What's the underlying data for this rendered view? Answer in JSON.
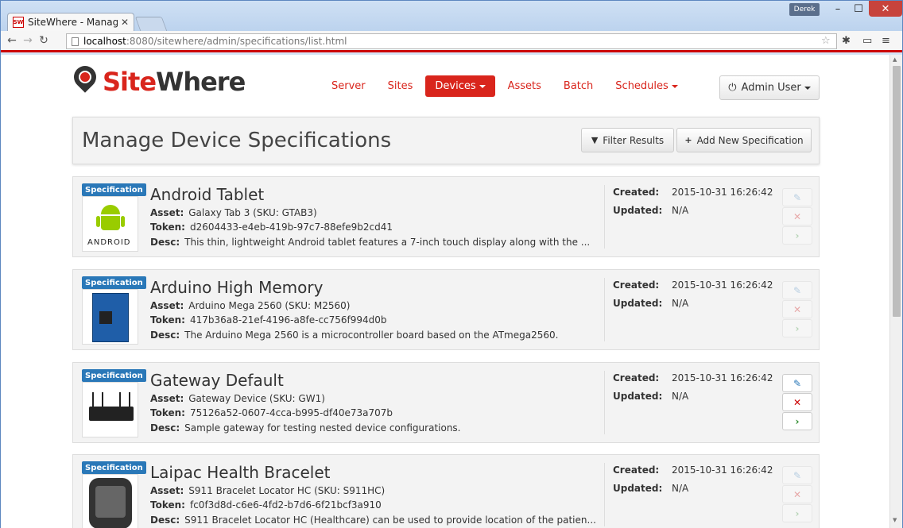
{
  "browser": {
    "tab_title": "SiteWhere - Manage",
    "favicon_text": "SW",
    "user_badge": "Derek",
    "url_host": "localhost",
    "url_path": ":8080/sitewhere/admin/specifications/list.html"
  },
  "header": {
    "logo_site": "Site",
    "logo_where": "Where",
    "nav": [
      "Server",
      "Sites",
      "Devices",
      "Assets",
      "Batch",
      "Schedules"
    ],
    "user_label": "Admin User"
  },
  "page": {
    "title": "Manage Device Specifications",
    "filter_label": "Filter Results",
    "add_label": "Add New Specification"
  },
  "labels": {
    "badge": "Specification",
    "asset": "Asset:",
    "token": "Token:",
    "desc": "Desc:",
    "created": "Created:",
    "updated": "Updated:",
    "android_word": "ANDROID"
  },
  "specs": [
    {
      "name": "Android Tablet",
      "asset": "Galaxy Tab 3 (SKU: GTAB3)",
      "token": "d2604433-e4eb-419b-97c7-88efe9b2cd41",
      "desc": "This thin, lightweight Android tablet features a 7-inch touch display along with the ...",
      "created": "2015-10-31 16:26:42",
      "updated": "N/A"
    },
    {
      "name": "Arduino High Memory",
      "asset": "Arduino Mega 2560 (SKU: M2560)",
      "token": "417b36a8-21ef-4196-a8fe-cc756f994d0b",
      "desc": "The Arduino Mega 2560 is a microcontroller board based on the ATmega2560.",
      "created": "2015-10-31 16:26:42",
      "updated": "N/A"
    },
    {
      "name": "Gateway Default",
      "asset": "Gateway Device (SKU: GW1)",
      "token": "75126a52-0607-4cca-b995-df40e73a707b",
      "desc": "Sample gateway for testing nested device configurations.",
      "created": "2015-10-31 16:26:42",
      "updated": "N/A"
    },
    {
      "name": "Laipac Health Bracelet",
      "asset": "S911 Bracelet Locator HC (SKU: S911HC)",
      "token": "fc0f3d8d-c6e6-4fd2-b7d6-6f21bcf3a910",
      "desc": "S911 Bracelet Locator HC (Healthcare) can be used to provide location of the patien...",
      "created": "2015-10-31 16:26:42",
      "updated": "N/A"
    }
  ],
  "colors": {
    "brand": "#d9251c",
    "badge": "#2a78b8"
  }
}
